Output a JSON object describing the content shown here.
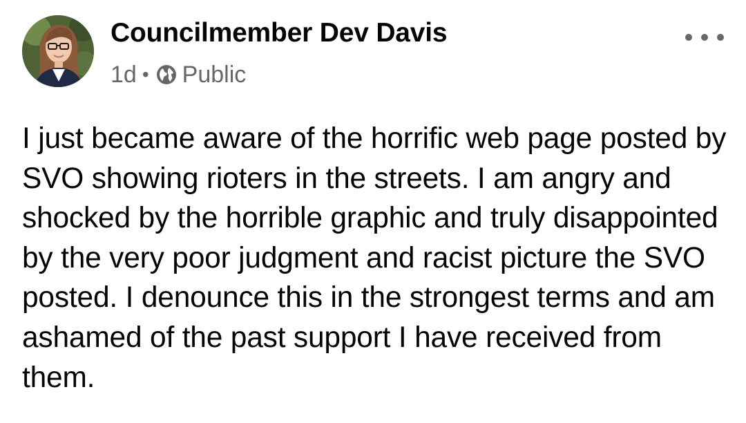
{
  "post": {
    "author": "Councilmember Dev Davis",
    "time": "1d",
    "separator": "•",
    "audience": "Public",
    "audience_icon": "globe-icon",
    "more_icon": "more-options-icon",
    "body": "I just became aware of the horrific web page posted by SVO showing rioters in the streets. I am angry and shocked by the horrible graphic and truly disappointed by the very poor judgment and racist picture the SVO posted. I denounce this in the strongest terms and am ashamed of the past support I have received from them."
  },
  "colors": {
    "text_primary": "#050505",
    "text_secondary": "#65676b",
    "background": "#ffffff"
  }
}
